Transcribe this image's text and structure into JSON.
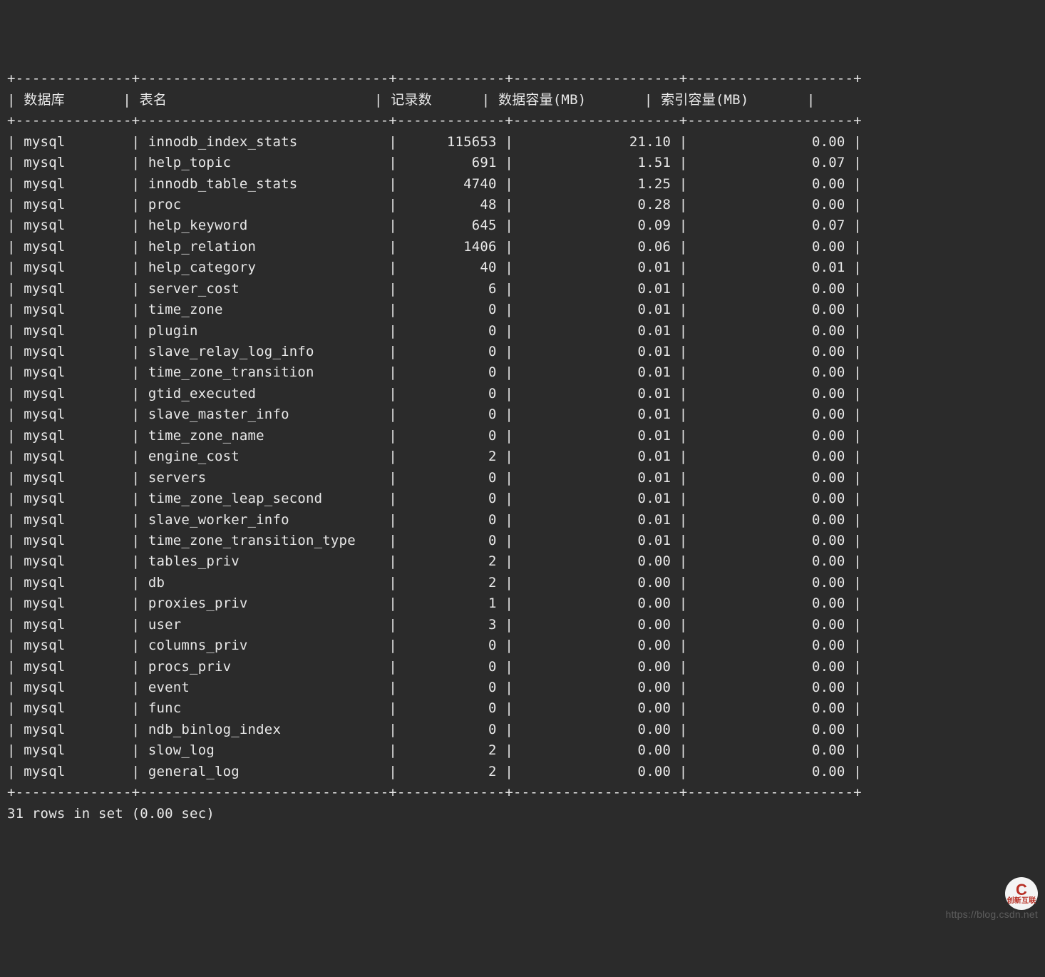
{
  "columns": [
    "数据库",
    "表名",
    "记录数",
    "数据容量(MB)",
    "索引容量(MB)"
  ],
  "rows": [
    {
      "db": "mysql",
      "table": "innodb_index_stats",
      "records": "115653",
      "data_mb": "21.10",
      "index_mb": "0.00"
    },
    {
      "db": "mysql",
      "table": "help_topic",
      "records": "691",
      "data_mb": "1.51",
      "index_mb": "0.07"
    },
    {
      "db": "mysql",
      "table": "innodb_table_stats",
      "records": "4740",
      "data_mb": "1.25",
      "index_mb": "0.00"
    },
    {
      "db": "mysql",
      "table": "proc",
      "records": "48",
      "data_mb": "0.28",
      "index_mb": "0.00"
    },
    {
      "db": "mysql",
      "table": "help_keyword",
      "records": "645",
      "data_mb": "0.09",
      "index_mb": "0.07"
    },
    {
      "db": "mysql",
      "table": "help_relation",
      "records": "1406",
      "data_mb": "0.06",
      "index_mb": "0.00"
    },
    {
      "db": "mysql",
      "table": "help_category",
      "records": "40",
      "data_mb": "0.01",
      "index_mb": "0.01"
    },
    {
      "db": "mysql",
      "table": "server_cost",
      "records": "6",
      "data_mb": "0.01",
      "index_mb": "0.00"
    },
    {
      "db": "mysql",
      "table": "time_zone",
      "records": "0",
      "data_mb": "0.01",
      "index_mb": "0.00"
    },
    {
      "db": "mysql",
      "table": "plugin",
      "records": "0",
      "data_mb": "0.01",
      "index_mb": "0.00"
    },
    {
      "db": "mysql",
      "table": "slave_relay_log_info",
      "records": "0",
      "data_mb": "0.01",
      "index_mb": "0.00"
    },
    {
      "db": "mysql",
      "table": "time_zone_transition",
      "records": "0",
      "data_mb": "0.01",
      "index_mb": "0.00"
    },
    {
      "db": "mysql",
      "table": "gtid_executed",
      "records": "0",
      "data_mb": "0.01",
      "index_mb": "0.00"
    },
    {
      "db": "mysql",
      "table": "slave_master_info",
      "records": "0",
      "data_mb": "0.01",
      "index_mb": "0.00"
    },
    {
      "db": "mysql",
      "table": "time_zone_name",
      "records": "0",
      "data_mb": "0.01",
      "index_mb": "0.00"
    },
    {
      "db": "mysql",
      "table": "engine_cost",
      "records": "2",
      "data_mb": "0.01",
      "index_mb": "0.00"
    },
    {
      "db": "mysql",
      "table": "servers",
      "records": "0",
      "data_mb": "0.01",
      "index_mb": "0.00"
    },
    {
      "db": "mysql",
      "table": "time_zone_leap_second",
      "records": "0",
      "data_mb": "0.01",
      "index_mb": "0.00"
    },
    {
      "db": "mysql",
      "table": "slave_worker_info",
      "records": "0",
      "data_mb": "0.01",
      "index_mb": "0.00"
    },
    {
      "db": "mysql",
      "table": "time_zone_transition_type",
      "records": "0",
      "data_mb": "0.01",
      "index_mb": "0.00"
    },
    {
      "db": "mysql",
      "table": "tables_priv",
      "records": "2",
      "data_mb": "0.00",
      "index_mb": "0.00"
    },
    {
      "db": "mysql",
      "table": "db",
      "records": "2",
      "data_mb": "0.00",
      "index_mb": "0.00"
    },
    {
      "db": "mysql",
      "table": "proxies_priv",
      "records": "1",
      "data_mb": "0.00",
      "index_mb": "0.00"
    },
    {
      "db": "mysql",
      "table": "user",
      "records": "3",
      "data_mb": "0.00",
      "index_mb": "0.00"
    },
    {
      "db": "mysql",
      "table": "columns_priv",
      "records": "0",
      "data_mb": "0.00",
      "index_mb": "0.00"
    },
    {
      "db": "mysql",
      "table": "procs_priv",
      "records": "0",
      "data_mb": "0.00",
      "index_mb": "0.00"
    },
    {
      "db": "mysql",
      "table": "event",
      "records": "0",
      "data_mb": "0.00",
      "index_mb": "0.00"
    },
    {
      "db": "mysql",
      "table": "func",
      "records": "0",
      "data_mb": "0.00",
      "index_mb": "0.00"
    },
    {
      "db": "mysql",
      "table": "ndb_binlog_index",
      "records": "0",
      "data_mb": "0.00",
      "index_mb": "0.00"
    },
    {
      "db": "mysql",
      "table": "slow_log",
      "records": "2",
      "data_mb": "0.00",
      "index_mb": "0.00"
    },
    {
      "db": "mysql",
      "table": "general_log",
      "records": "2",
      "data_mb": "0.00",
      "index_mb": "0.00"
    }
  ],
  "footer": "31 rows in set (0.00 sec)",
  "widths": {
    "db": 12,
    "table": 28,
    "records": 11,
    "data_mb": 18,
    "index_mb": 18
  },
  "watermark_url": "https://blog.csdn.net",
  "watermark_brand": "创新互联"
}
